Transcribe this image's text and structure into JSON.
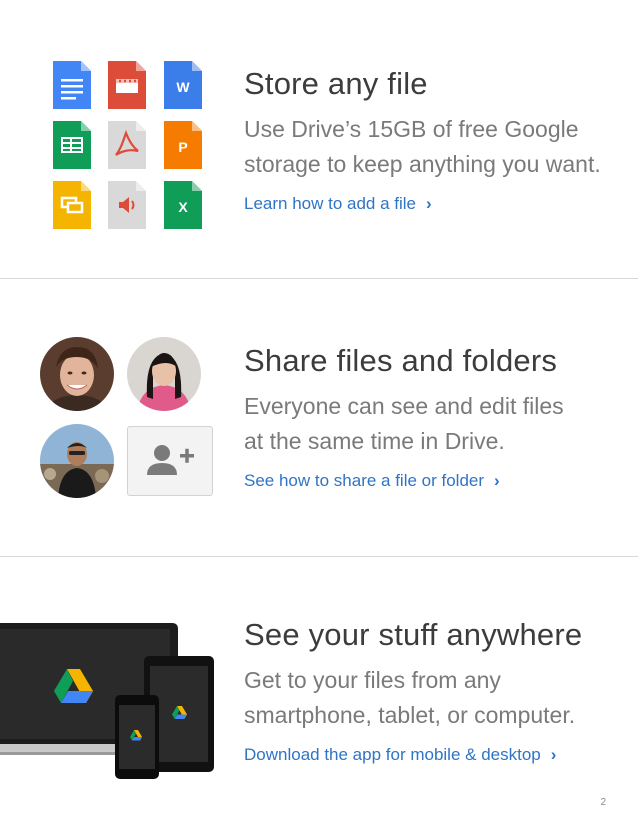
{
  "sections": [
    {
      "title": "Store any file",
      "desc_lines": [
        "Use Drive’s 15GB of free Google",
        "storage to keep anything you want."
      ],
      "link": "Learn how to add a file",
      "file_icons": [
        {
          "name": "docs-icon",
          "color": "#4285f4"
        },
        {
          "name": "video-icon",
          "color": "#dd4b39"
        },
        {
          "name": "word-icon",
          "color": "#3b7de9",
          "glyph": "W"
        },
        {
          "name": "sheets-icon",
          "color": "#0f9d58"
        },
        {
          "name": "pdf-icon",
          "color": "#d9d9d9"
        },
        {
          "name": "powerpoint-icon",
          "color": "#f57c00",
          "glyph": "P"
        },
        {
          "name": "slides-icon",
          "color": "#f4b400"
        },
        {
          "name": "audio-icon",
          "color": "#d9d9d9"
        },
        {
          "name": "excel-icon",
          "color": "#0f9d58",
          "glyph": "X"
        }
      ]
    },
    {
      "title": "Share files and folders",
      "desc_lines": [
        "Everyone can see and edit files",
        "at the same time in Drive."
      ],
      "link": "See how to share a file or folder"
    },
    {
      "title": "See your stuff anywhere",
      "desc_lines": [
        "Get to your files from any",
        "smartphone, tablet, or computer."
      ],
      "link": "Download the app for mobile & desktop"
    }
  ],
  "chevron": "›",
  "page_number": "2",
  "colors": {
    "link": "#2f74c6",
    "title": "#3c3c3c",
    "desc": "#7a7a7a"
  }
}
